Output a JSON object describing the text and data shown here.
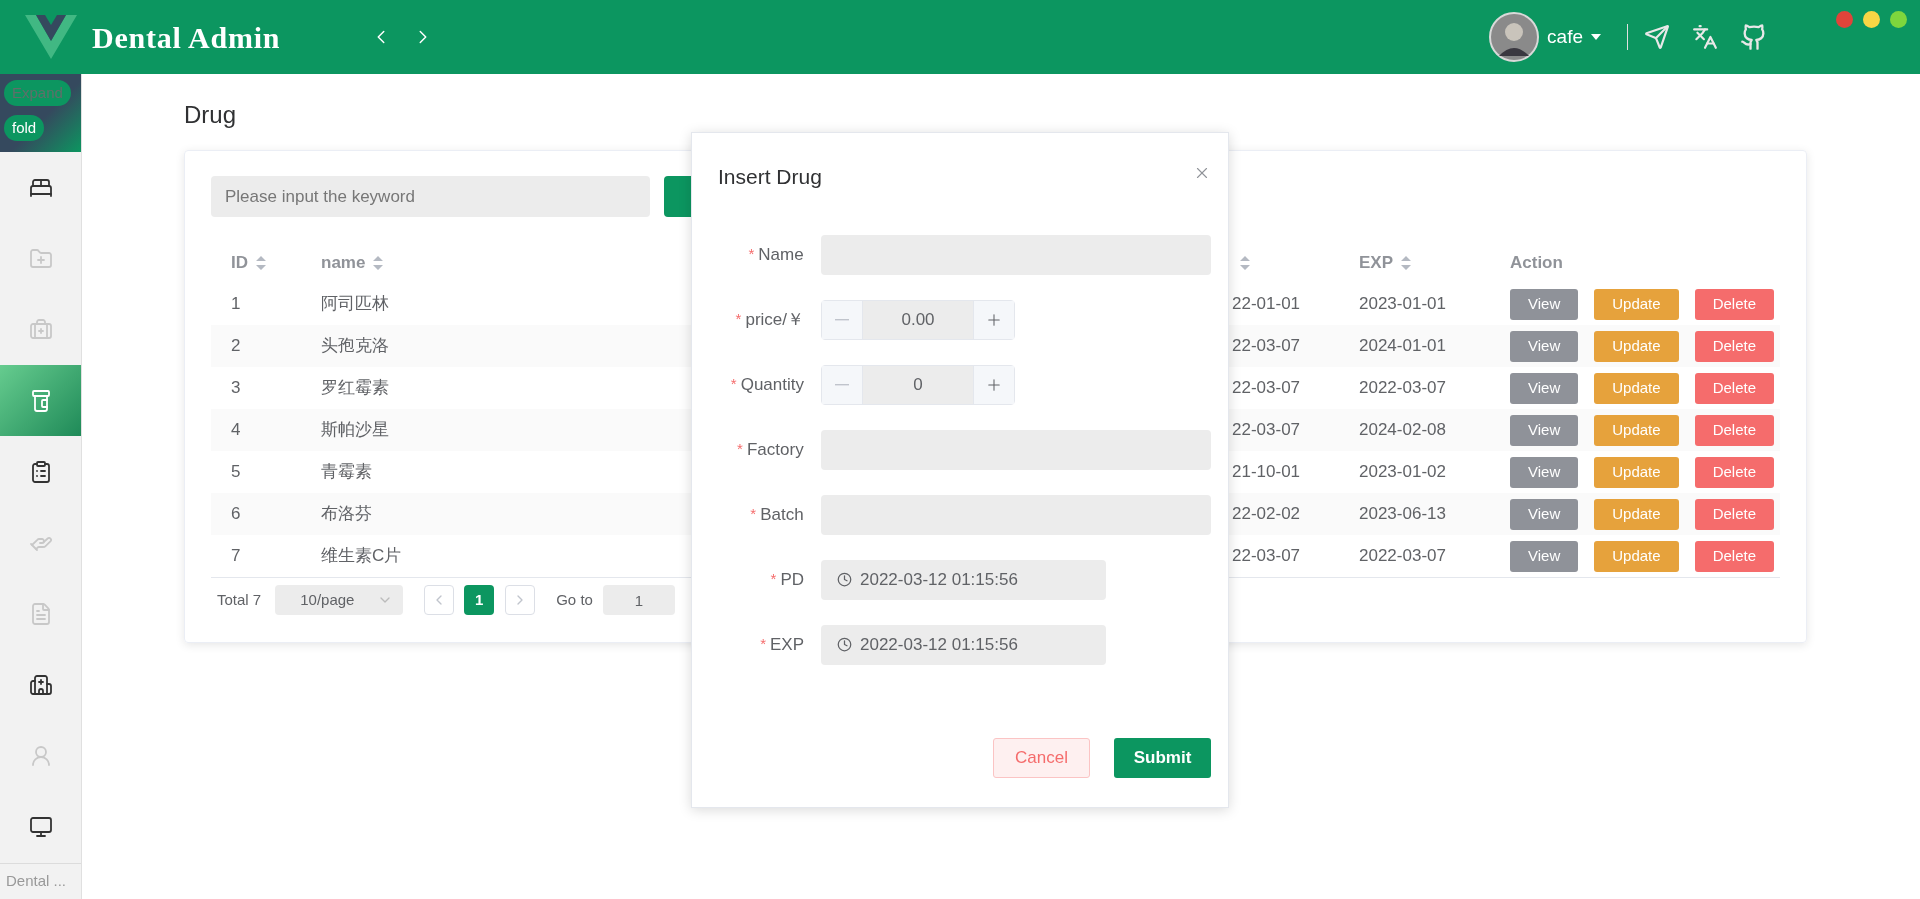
{
  "header": {
    "title": "Dental Admin",
    "user": {
      "name": "cafe"
    }
  },
  "sidebar": {
    "toggles": [
      {
        "label": "Expand",
        "disabled": true
      },
      {
        "label": "fold",
        "disabled": false
      }
    ],
    "menu": [
      {
        "selected": false,
        "disabled": false
      },
      {
        "selected": false,
        "disabled": true
      },
      {
        "selected": false,
        "disabled": true
      },
      {
        "selected": true,
        "disabled": false
      },
      {
        "selected": false,
        "disabled": false
      },
      {
        "selected": false,
        "disabled": true
      },
      {
        "selected": false,
        "disabled": true
      },
      {
        "selected": false,
        "disabled": false
      },
      {
        "selected": false,
        "disabled": true
      },
      {
        "selected": false,
        "disabled": false
      }
    ],
    "footer": "Dental ..."
  },
  "page": {
    "title": "Drug",
    "search": {
      "placeholder": "Please input the keyword"
    },
    "table": {
      "columns": [
        {
          "label": "ID",
          "sortable": true
        },
        {
          "label": "name",
          "sortable": true
        },
        {
          "sortable": true
        },
        {
          "label": "EXP",
          "sortable": true
        },
        {
          "label": "Action",
          "sortable": false
        }
      ],
      "rows": [
        {
          "id": "1",
          "name": "阿司匹林",
          "column_3": "22-01-01",
          "exp": "2023-01-01",
          "actions": [
            {
              "label": "View",
              "kind": "view"
            },
            {
              "label": "Update",
              "kind": "update"
            },
            {
              "label": "Delete",
              "kind": "delete"
            }
          ]
        },
        {
          "id": "2",
          "name": "头孢克洛",
          "column_3": "22-03-07",
          "exp": "2024-01-01",
          "actions": [
            {
              "label": "View",
              "kind": "view"
            },
            {
              "label": "Update",
              "kind": "update"
            },
            {
              "label": "Delete",
              "kind": "delete"
            }
          ]
        },
        {
          "id": "3",
          "name": "罗红霉素",
          "column_3": "22-03-07",
          "exp": "2022-03-07",
          "actions": [
            {
              "label": "View",
              "kind": "view"
            },
            {
              "label": "Update",
              "kind": "update"
            },
            {
              "label": "Delete",
              "kind": "delete"
            }
          ]
        },
        {
          "id": "4",
          "name": "斯帕沙星",
          "column_3": "22-03-07",
          "exp": "2024-02-08",
          "actions": [
            {
              "label": "View",
              "kind": "view"
            },
            {
              "label": "Update",
              "kind": "update"
            },
            {
              "label": "Delete",
              "kind": "delete"
            }
          ]
        },
        {
          "id": "5",
          "name": "青霉素",
          "column_3": "21-10-01",
          "exp": "2023-01-02",
          "actions": [
            {
              "label": "View",
              "kind": "view"
            },
            {
              "label": "Update",
              "kind": "update"
            },
            {
              "label": "Delete",
              "kind": "delete"
            }
          ]
        },
        {
          "id": "6",
          "name": "布洛芬",
          "column_3": "22-02-02",
          "exp": "2023-06-13",
          "actions": [
            {
              "label": "View",
              "kind": "view"
            },
            {
              "label": "Update",
              "kind": "update"
            },
            {
              "label": "Delete",
              "kind": "delete"
            }
          ]
        },
        {
          "id": "7",
          "name": "维生素C片",
          "column_3": "22-03-07",
          "exp": "2022-03-07",
          "actions": [
            {
              "label": "View",
              "kind": "view"
            },
            {
              "label": "Update",
              "kind": "update"
            },
            {
              "label": "Delete",
              "kind": "delete"
            }
          ]
        }
      ]
    },
    "pagination": {
      "total": "Total 7",
      "page_size": "10/page",
      "pages": [
        {
          "label": "1",
          "selected": true
        }
      ],
      "goto_label": "Go to",
      "goto_value": "1"
    }
  },
  "dialog": {
    "title": "Insert Drug",
    "fields": [
      {
        "kind": "text",
        "required_mark": "*",
        "label": "Name"
      },
      {
        "kind": "number",
        "required_mark": "*",
        "label": "price/￥",
        "value": "0.00"
      },
      {
        "kind": "number",
        "required_mark": "*",
        "label": "Quantity",
        "value": "0"
      },
      {
        "kind": "text",
        "required_mark": "*",
        "label": "Factory"
      },
      {
        "kind": "text",
        "required_mark": "*",
        "label": "Batch"
      },
      {
        "kind": "datetime",
        "required_mark": "*",
        "label": "PD",
        "value": "2022-03-12 01:15:56"
      },
      {
        "kind": "datetime",
        "required_mark": "*",
        "label": "EXP",
        "value": "2022-03-12 01:15:56"
      }
    ],
    "buttons": [
      {
        "label": "Cancel",
        "kind": "cancel"
      },
      {
        "label": "Submit",
        "kind": "primary"
      }
    ]
  }
}
